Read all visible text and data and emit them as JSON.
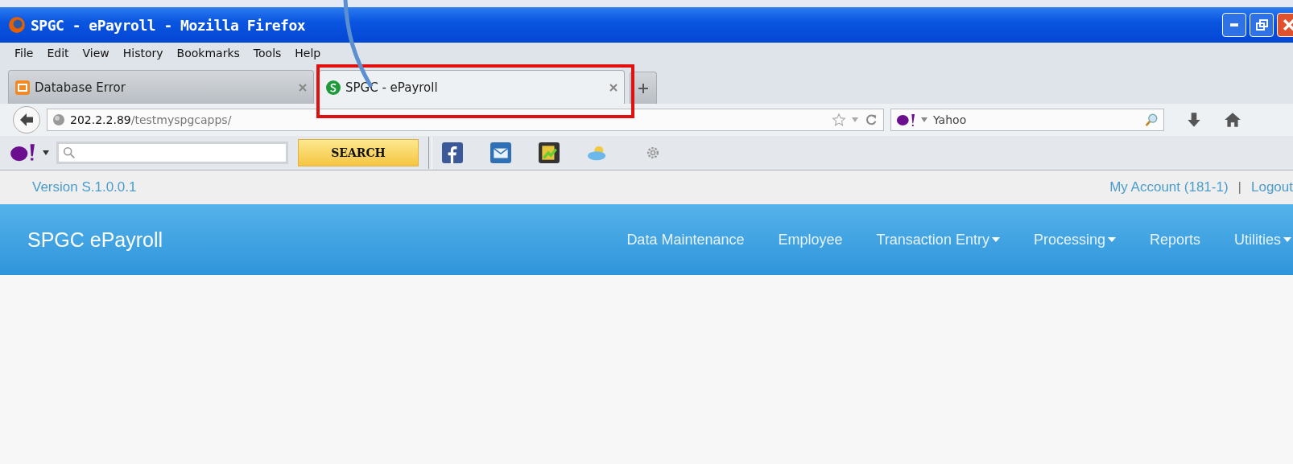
{
  "window": {
    "title": "SPGC - ePayroll - Mozilla Firefox"
  },
  "menu": [
    "File",
    "Edit",
    "View",
    "History",
    "Bookmarks",
    "Tools",
    "Help"
  ],
  "tabs": [
    {
      "label": "Database Error",
      "selected": false,
      "kind": "xampp",
      "highlighted": false
    },
    {
      "label": "SPGC - ePayroll",
      "selected": true,
      "kind": "spgc",
      "highlighted": true
    }
  ],
  "address_bar": {
    "host": "202.2.2.89",
    "path": "/testmyspgcapps/"
  },
  "search_bar": {
    "value": "Yahoo"
  },
  "yahoo_toolbar": {
    "search_button": "SEARCH"
  },
  "top_bar": {
    "version": "Version S.1.0.0.1",
    "account": "My Account (181-1)",
    "separator": "|",
    "logout": "Logout"
  },
  "app_nav": {
    "brand": "SPGC ePayroll",
    "items": [
      {
        "label": "Data Maintenance",
        "dropdown": false
      },
      {
        "label": "Employee",
        "dropdown": false
      },
      {
        "label": "Transaction Entry",
        "dropdown": true
      },
      {
        "label": "Processing",
        "dropdown": true
      },
      {
        "label": "Reports",
        "dropdown": false
      },
      {
        "label": "Utilities",
        "dropdown": true
      }
    ]
  }
}
